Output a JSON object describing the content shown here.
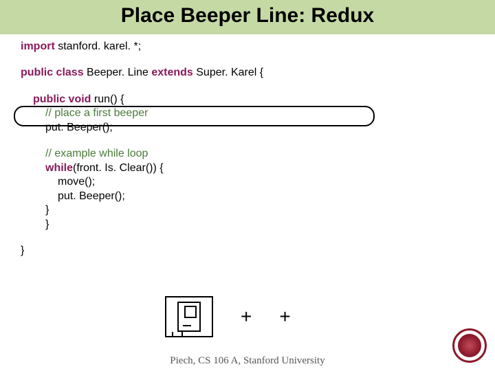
{
  "title": "Place Beeper Line: Redux",
  "code": {
    "l1_kw": "import",
    "l1_rest": " stanford. karel. *;",
    "l2_kw1": "public class",
    "l2_mid": " Beeper. Line ",
    "l2_kw2": "extends",
    "l2_rest": " Super. Karel {",
    "l3_kw": "public void",
    "l3_rest": " run() {",
    "l4": "// place a first beeper",
    "l5": "put. Beeper();",
    "l6": "// example while loop",
    "l7_kw": "while",
    "l7_rest": "(front. Is. Clear()) {",
    "l8": "move();",
    "l9": "put. Beeper();",
    "l10": "}",
    "l11": "}",
    "l12": "}"
  },
  "plus1": "+",
  "plus2": "+",
  "footer": "Piech, CS 106 A, Stanford University"
}
